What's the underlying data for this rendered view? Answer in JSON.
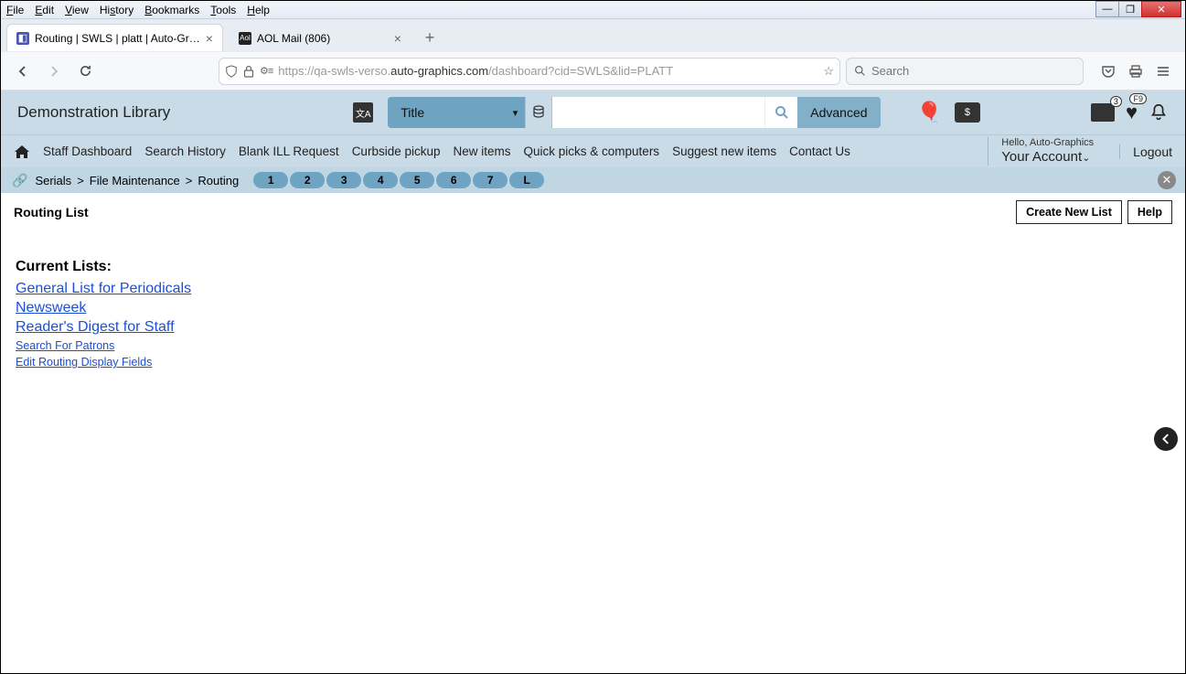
{
  "browser": {
    "menus": [
      "File",
      "Edit",
      "View",
      "History",
      "Bookmarks",
      "Tools",
      "Help"
    ],
    "tabs": [
      {
        "title": "Routing | SWLS | platt | Auto-Gr…",
        "active": true
      },
      {
        "title": "AOL Mail (806)",
        "active": false
      }
    ],
    "url_prefix": "https://qa-swls-verso.",
    "url_host": "auto-graphics.com",
    "url_path": "/dashboard?cid=SWLS&lid=PLATT",
    "search_placeholder": "Search"
  },
  "app": {
    "library_name": "Demonstration Library",
    "search_type": "Title",
    "advanced_label": "Advanced",
    "list_badge": "3",
    "heart_badge": "F9",
    "nav": [
      "Staff Dashboard",
      "Search History",
      "Blank ILL Request",
      "Curbside pickup",
      "New items",
      "Quick picks & computers",
      "Suggest new items",
      "Contact Us"
    ],
    "hello": "Hello, Auto-Graphics",
    "your_account": "Your Account",
    "logout": "Logout"
  },
  "crumbs": {
    "a": "Serials",
    "b": "File Maintenance",
    "c": "Routing",
    "sep": ">"
  },
  "pills": [
    "1",
    "2",
    "3",
    "4",
    "5",
    "6",
    "7",
    "L"
  ],
  "page": {
    "title": "Routing List",
    "btn_create": "Create New List",
    "btn_help": "Help",
    "heading": "Current Lists:",
    "lists": [
      "General List for Periodicals",
      "Newsweek",
      "Reader's Digest for Staff"
    ],
    "link_search_patrons": "Search For Patrons",
    "link_edit_fields": "Edit Routing Display Fields"
  }
}
